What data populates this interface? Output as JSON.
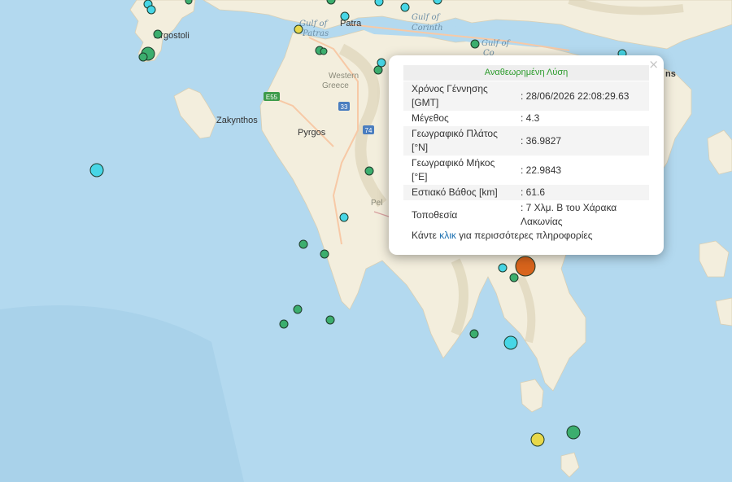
{
  "map": {
    "labels": {
      "argostoli": "Argostoli",
      "zakynthos": "Zakynthos",
      "patra": "Patra",
      "pyrgos": "Pyrgos",
      "gulf_patras_1": "Gulf of",
      "gulf_patras_2": "Patras",
      "gulf_corinth_1": "Gulf of",
      "gulf_corinth_2": "Corinth",
      "gulf_co_1": "Gulf of",
      "gulf_co_2": "Co",
      "western_greece_1": "Western",
      "western_greece_2": "Greece",
      "pel": "Pel",
      "athens_partial": "ns",
      "road_e55": "E55",
      "road_74": "74",
      "road_33": "33"
    },
    "colors": {
      "sea": "#b3d9ef",
      "land": "#f3eedd",
      "quake_green": "#3cae6e",
      "quake_cyan": "#47d6e6",
      "quake_yellow": "#e8d84a",
      "quake_selected": "#d8641c"
    }
  },
  "popup": {
    "title": "Αναθεωρημένη Λύση",
    "close_label": "×",
    "rows": [
      {
        "label": "Χρόνος Γέννησης [GMT]",
        "value": ": 28/06/2026 22:08:29.63"
      },
      {
        "label": "Μέγεθος",
        "value": ": 4.3"
      },
      {
        "label": "Γεωγραφικό Πλάτος [°N]",
        "value": ": 36.9827"
      },
      {
        "label": "Γεωγραφικό Μήκος [°E]",
        "value": ": 22.9843"
      },
      {
        "label": "Εστιακό Βάθος [km]",
        "value": ": 61.6"
      },
      {
        "label": "Τοποθεσία",
        "value": ": 7 Χλμ. Β του Χάρακα Λακωνίας"
      }
    ],
    "more_prefix": "Κάντε ",
    "more_link": "κλικ",
    "more_suffix": " για περισσότερες πληροφορίες"
  }
}
